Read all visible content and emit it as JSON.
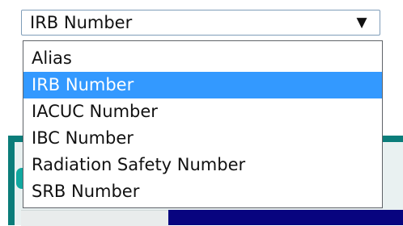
{
  "select": {
    "value": "IRB Number",
    "arrow_icon": "triangle-down-icon"
  },
  "dropdown": {
    "options": [
      {
        "label": "Alias",
        "selected": false
      },
      {
        "label": "IRB Number",
        "selected": true
      },
      {
        "label": "IACUC Number",
        "selected": false
      },
      {
        "label": "IBC Number",
        "selected": false
      },
      {
        "label": "Radiation Safety Number",
        "selected": false
      },
      {
        "label": "SRB Number",
        "selected": false
      }
    ],
    "highlight_color": "#3399ff"
  },
  "background": {
    "panel_color": "#0b7d7a",
    "bar_color": "#08047f"
  }
}
